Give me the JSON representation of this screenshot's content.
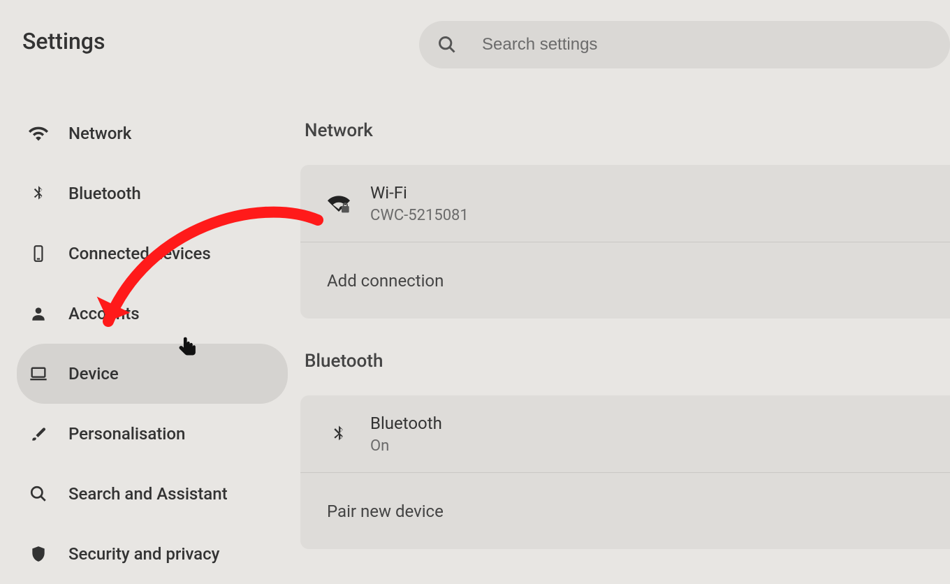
{
  "title": "Settings",
  "search": {
    "placeholder": "Search settings"
  },
  "sidebar": {
    "items": [
      {
        "label": "Network"
      },
      {
        "label": "Bluetooth"
      },
      {
        "label": "Connected devices"
      },
      {
        "label": "Accounts"
      },
      {
        "label": "Device"
      },
      {
        "label": "Personalisation"
      },
      {
        "label": "Search and Assistant"
      },
      {
        "label": "Security and privacy"
      }
    ]
  },
  "main": {
    "network": {
      "title": "Network",
      "wifi": {
        "label": "Wi-Fi",
        "value": "CWC-5215081"
      },
      "add_connection": "Add connection"
    },
    "bluetooth": {
      "title": "Bluetooth",
      "bt": {
        "label": "Bluetooth",
        "value": "On"
      },
      "pair": "Pair new device"
    }
  }
}
